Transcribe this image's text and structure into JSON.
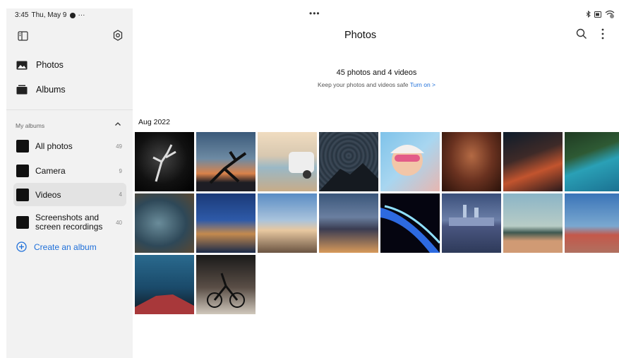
{
  "status_bar": {
    "time": "3:45",
    "date": "Thu, May 9",
    "extra": "···"
  },
  "top_dots": "•••",
  "sidebar": {
    "nav": [
      {
        "label": "Photos",
        "icon": "image-icon"
      },
      {
        "label": "Albums",
        "icon": "albums-icon"
      }
    ],
    "section_label": "My albums",
    "albums": [
      {
        "label": "All photos",
        "count": "49"
      },
      {
        "label": "Camera",
        "count": "9"
      },
      {
        "label": "Videos",
        "count": "4",
        "active": true
      },
      {
        "label": "Screenshots and screen recordings",
        "count": "40"
      }
    ],
    "create_label": "Create an album"
  },
  "header": {
    "title": "Photos"
  },
  "summary": {
    "count_text": "45 photos and 4 videos",
    "backup_text": "Keep your photos and videos safe",
    "backup_link": "Turn on >"
  },
  "date_group": "Aug 2022",
  "colors": {
    "accent": "#1e6fd9",
    "sidebar_bg": "#f2f2f2"
  }
}
